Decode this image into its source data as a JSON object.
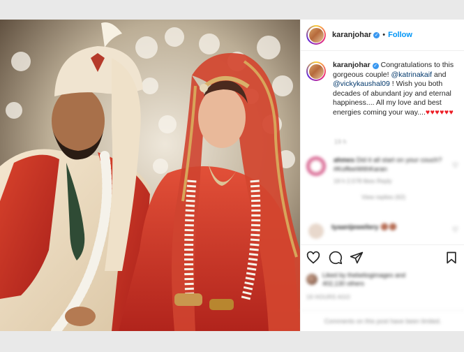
{
  "post": {
    "username": "karanjohar",
    "verified_icon": "verified-badge-icon",
    "separator": "•",
    "follow_label": "Follow",
    "caption": {
      "prefix": "Congratulations to this gorgeous couple! ",
      "mention1": "@katrinakaif",
      "middle1": " and ",
      "mention2": "@vickykaushal09",
      "middle2": " ! Wish you both decades of abundant joy and eternal happiness.... All my love and best energies coming your way....",
      "hearts": "♥♥♥♥♥♥"
    },
    "caption_time": "19 h"
  },
  "comments": [
    {
      "username": "ahmes",
      "text": "Did it all start on your couch? #KoffeeWithKaran",
      "meta": "19 h   2,578 likes   Reply",
      "view_replies": "View replies (62)"
    },
    {
      "username": "tyaanijewellery",
      "text": "🟤🟤"
    }
  ],
  "likes": {
    "text": "Liked by thebeliogimages and",
    "text2": "402,130 others"
  },
  "time_ago": "19 HOURS AGO",
  "footer": "Comments on this post have been limited.",
  "colors": {
    "accent": "#0095f6",
    "verified": "#3897f0",
    "hearts": "#ed1c24"
  }
}
